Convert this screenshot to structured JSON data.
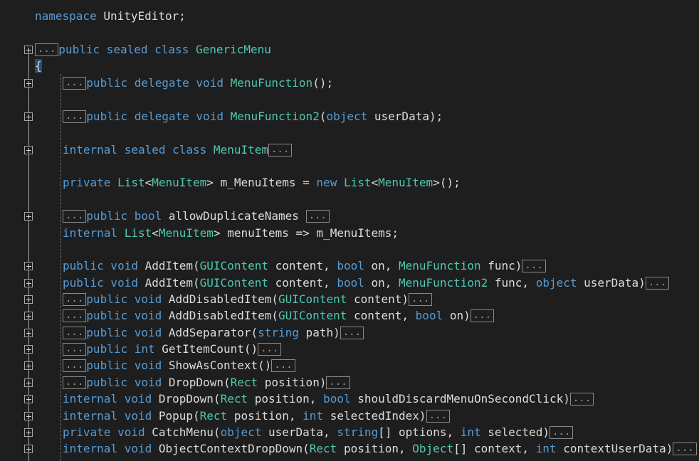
{
  "colors": {
    "background": "#1e1e1e",
    "keyword": "#569cd6",
    "type": "#4ec9b0",
    "text": "#dcdcdc",
    "collapsed_box_border": "#8a8a8a"
  },
  "icons": {
    "fold": "plus-box-icon",
    "collapsed": "ellipsis-box"
  },
  "code_lines": [
    {
      "fold": false,
      "indent": 0,
      "tokens": [
        {
          "k": "kw",
          "t": "namespace"
        },
        {
          "k": "tx",
          "t": " UnityEditor;"
        }
      ]
    },
    {
      "fold": true,
      "indent": 0,
      "lead_box": true,
      "tokens": [
        {
          "k": "kw",
          "t": "public sealed class "
        },
        {
          "k": "ty",
          "t": "GenericMenu"
        }
      ]
    },
    {
      "fold": false,
      "indent": 0,
      "tokens": [
        {
          "k": "brace",
          "t": "{"
        }
      ]
    },
    {
      "fold": true,
      "indent": 1,
      "lead_box": true,
      "tokens": [
        {
          "k": "kw",
          "t": "public delegate void "
        },
        {
          "k": "ty",
          "t": "MenuFunction"
        },
        {
          "k": "tx",
          "t": "();"
        }
      ]
    },
    {
      "fold": true,
      "indent": 1,
      "lead_box": true,
      "tokens": [
        {
          "k": "kw",
          "t": "public delegate void "
        },
        {
          "k": "ty",
          "t": "MenuFunction2"
        },
        {
          "k": "tx",
          "t": "("
        },
        {
          "k": "kw",
          "t": "object"
        },
        {
          "k": "tx",
          "t": " userData);"
        }
      ]
    },
    {
      "fold": true,
      "indent": 1,
      "trail_box": true,
      "tokens": [
        {
          "k": "kw",
          "t": "internal sealed class "
        },
        {
          "k": "ty",
          "t": "MenuItem"
        }
      ]
    },
    {
      "fold": false,
      "indent": 1,
      "tokens": [
        {
          "k": "kw",
          "t": "private "
        },
        {
          "k": "ty",
          "t": "List"
        },
        {
          "k": "tx",
          "t": "<"
        },
        {
          "k": "ty",
          "t": "MenuItem"
        },
        {
          "k": "tx",
          "t": "> m_MenuItems = "
        },
        {
          "k": "kw",
          "t": "new "
        },
        {
          "k": "ty",
          "t": "List"
        },
        {
          "k": "tx",
          "t": "<"
        },
        {
          "k": "ty",
          "t": "MenuItem"
        },
        {
          "k": "tx",
          "t": ">();"
        }
      ]
    },
    {
      "fold": true,
      "indent": 1,
      "lead_box": true,
      "trail_box_space": true,
      "tokens": [
        {
          "k": "kw",
          "t": "public bool "
        },
        {
          "k": "tx",
          "t": "allowDuplicateNames"
        }
      ]
    },
    {
      "fold": false,
      "indent": 1,
      "tokens": [
        {
          "k": "kw",
          "t": "internal "
        },
        {
          "k": "ty",
          "t": "List"
        },
        {
          "k": "tx",
          "t": "<"
        },
        {
          "k": "ty",
          "t": "MenuItem"
        },
        {
          "k": "tx",
          "t": "> menuItems => m_MenuItems;"
        }
      ]
    },
    {
      "fold": true,
      "indent": 1,
      "trail_box": true,
      "tokens": [
        {
          "k": "kw",
          "t": "public void "
        },
        {
          "k": "tx",
          "t": "AddItem("
        },
        {
          "k": "ty",
          "t": "GUIContent"
        },
        {
          "k": "tx",
          "t": " content, "
        },
        {
          "k": "kw",
          "t": "bool"
        },
        {
          "k": "tx",
          "t": " on, "
        },
        {
          "k": "ty",
          "t": "MenuFunction"
        },
        {
          "k": "tx",
          "t": " func)"
        }
      ]
    },
    {
      "fold": true,
      "indent": 1,
      "trail_box": true,
      "tokens": [
        {
          "k": "kw",
          "t": "public void "
        },
        {
          "k": "tx",
          "t": "AddItem("
        },
        {
          "k": "ty",
          "t": "GUIContent"
        },
        {
          "k": "tx",
          "t": " content, "
        },
        {
          "k": "kw",
          "t": "bool"
        },
        {
          "k": "tx",
          "t": " on, "
        },
        {
          "k": "ty",
          "t": "MenuFunction2"
        },
        {
          "k": "tx",
          "t": " func, "
        },
        {
          "k": "kw",
          "t": "object"
        },
        {
          "k": "tx",
          "t": " userData)"
        }
      ]
    },
    {
      "fold": true,
      "indent": 1,
      "lead_box": true,
      "trail_box": true,
      "tokens": [
        {
          "k": "kw",
          "t": "public void "
        },
        {
          "k": "tx",
          "t": "AddDisabledItem("
        },
        {
          "k": "ty",
          "t": "GUIContent"
        },
        {
          "k": "tx",
          "t": " content)"
        }
      ]
    },
    {
      "fold": true,
      "indent": 1,
      "lead_box": true,
      "trail_box": true,
      "tokens": [
        {
          "k": "kw",
          "t": "public void "
        },
        {
          "k": "tx",
          "t": "AddDisabledItem("
        },
        {
          "k": "ty",
          "t": "GUIContent"
        },
        {
          "k": "tx",
          "t": " content, "
        },
        {
          "k": "kw",
          "t": "bool"
        },
        {
          "k": "tx",
          "t": " on)"
        }
      ]
    },
    {
      "fold": true,
      "indent": 1,
      "lead_box": true,
      "trail_box": true,
      "tokens": [
        {
          "k": "kw",
          "t": "public void "
        },
        {
          "k": "tx",
          "t": "AddSeparator("
        },
        {
          "k": "kw",
          "t": "string"
        },
        {
          "k": "tx",
          "t": " path)"
        }
      ]
    },
    {
      "fold": true,
      "indent": 1,
      "lead_box": true,
      "trail_box": true,
      "tokens": [
        {
          "k": "kw",
          "t": "public int "
        },
        {
          "k": "tx",
          "t": "GetItemCount()"
        }
      ]
    },
    {
      "fold": true,
      "indent": 1,
      "lead_box": true,
      "trail_box": true,
      "tokens": [
        {
          "k": "kw",
          "t": "public void "
        },
        {
          "k": "tx",
          "t": "ShowAsContext()"
        }
      ]
    },
    {
      "fold": true,
      "indent": 1,
      "lead_box": true,
      "trail_box": true,
      "tokens": [
        {
          "k": "kw",
          "t": "public void "
        },
        {
          "k": "tx",
          "t": "DropDown("
        },
        {
          "k": "ty",
          "t": "Rect"
        },
        {
          "k": "tx",
          "t": " position)"
        }
      ]
    },
    {
      "fold": true,
      "indent": 1,
      "trail_box": true,
      "tokens": [
        {
          "k": "kw",
          "t": "internal void "
        },
        {
          "k": "tx",
          "t": "DropDown("
        },
        {
          "k": "ty",
          "t": "Rect"
        },
        {
          "k": "tx",
          "t": " position, "
        },
        {
          "k": "kw",
          "t": "bool"
        },
        {
          "k": "tx",
          "t": " shouldDiscardMenuOnSecondClick)"
        }
      ]
    },
    {
      "fold": true,
      "indent": 1,
      "trail_box": true,
      "tokens": [
        {
          "k": "kw",
          "t": "internal void "
        },
        {
          "k": "tx",
          "t": "Popup("
        },
        {
          "k": "ty",
          "t": "Rect"
        },
        {
          "k": "tx",
          "t": " position, "
        },
        {
          "k": "kw",
          "t": "int"
        },
        {
          "k": "tx",
          "t": " selectedIndex)"
        }
      ]
    },
    {
      "fold": true,
      "indent": 1,
      "trail_box": true,
      "tokens": [
        {
          "k": "kw",
          "t": "private void "
        },
        {
          "k": "tx",
          "t": "CatchMenu("
        },
        {
          "k": "kw",
          "t": "object"
        },
        {
          "k": "tx",
          "t": " userData, "
        },
        {
          "k": "kw",
          "t": "string"
        },
        {
          "k": "tx",
          "t": "[] options, "
        },
        {
          "k": "kw",
          "t": "int"
        },
        {
          "k": "tx",
          "t": " selected)"
        }
      ]
    },
    {
      "fold": true,
      "indent": 1,
      "trail_box": true,
      "tokens": [
        {
          "k": "kw",
          "t": "internal void "
        },
        {
          "k": "tx",
          "t": "ObjectContextDropDown("
        },
        {
          "k": "ty",
          "t": "Rect"
        },
        {
          "k": "tx",
          "t": " position, "
        },
        {
          "k": "ty",
          "t": "Object"
        },
        {
          "k": "tx",
          "t": "[] context, "
        },
        {
          "k": "kw",
          "t": "int"
        },
        {
          "k": "tx",
          "t": " contextUserData)"
        }
      ]
    }
  ],
  "collapsed_label": "..."
}
